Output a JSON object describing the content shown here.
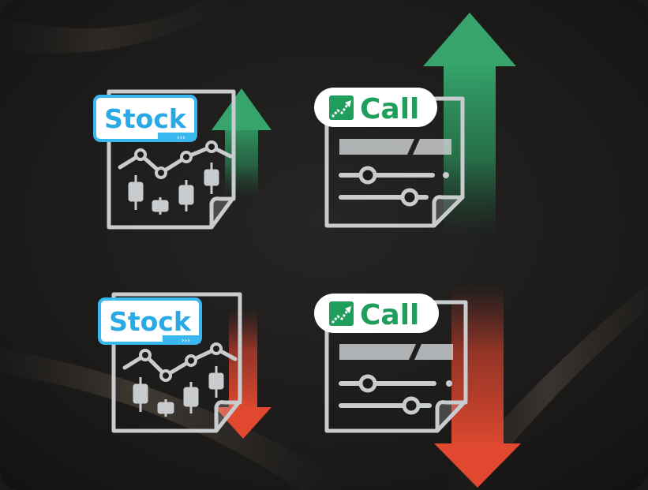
{
  "colors": {
    "background": "#1c1b1a",
    "stock_label_text": "#2aa9e6",
    "stock_label_fill": "#ffffff",
    "stock_label_border": "#3bb7f0",
    "call_label_text": "#1f9d5c",
    "call_label_fill": "#ffffff",
    "call_icon_fill": "#1f9d5c",
    "doc_stroke": "#c9cccf",
    "up_arrow": "#2f9d66",
    "down_arrow": "#d6452f"
  },
  "tiles": [
    {
      "id": "stock-up",
      "kind": "stock",
      "direction": "up",
      "label": "Stock"
    },
    {
      "id": "call-up",
      "kind": "call",
      "direction": "up",
      "label": "Call"
    },
    {
      "id": "stock-down",
      "kind": "stock",
      "direction": "down",
      "label": "Stock"
    },
    {
      "id": "call-down",
      "kind": "call",
      "direction": "down",
      "label": "Call"
    }
  ],
  "icons": {
    "stock_label_glyph": "›››",
    "call_label_icon": "trend-up-icon",
    "up": "arrow-up-icon",
    "down": "arrow-down-icon"
  }
}
